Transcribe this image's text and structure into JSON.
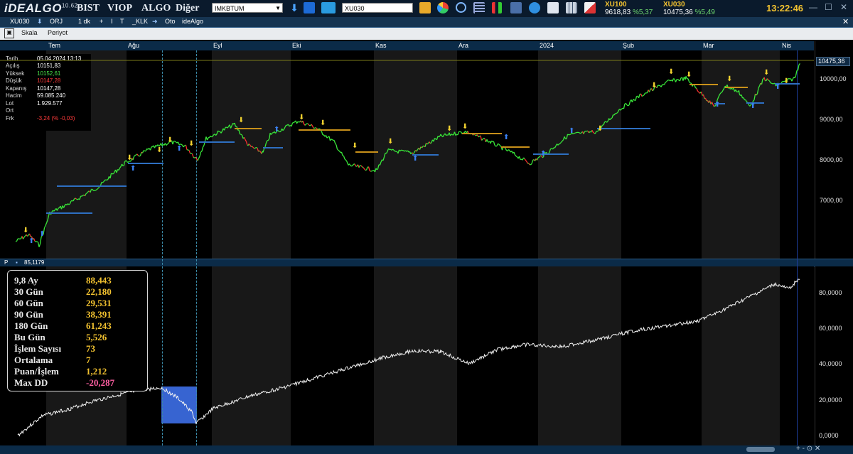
{
  "app": {
    "logo": "iDEALGO",
    "version": "10.62",
    "menu": [
      "BIST",
      "VIOP",
      "ALGO",
      "Diğer"
    ],
    "symbol_select": "IMKBTUM",
    "symbol_input": "XU030",
    "clock": "13:22:46"
  },
  "tickers": [
    {
      "name": "XU100",
      "value": "9618,83",
      "pct": "%5,37"
    },
    {
      "name": "XU030",
      "value": "10475,36",
      "pct": "%5,49"
    }
  ],
  "toolbar_icons": [
    "download-arrow-icon",
    "monitor-icon",
    "folder-icon",
    "pie-chart-icon",
    "magnifier-icon",
    "bars-list-icon",
    "candlestick-icon",
    "camera-icon",
    "globe-icon",
    "cube-icon",
    "grid-icon",
    "brush-icon"
  ],
  "chart_tab": {
    "items": [
      "XU030",
      "ORJ",
      "1 dk",
      "+",
      "I",
      "T",
      "_KLK",
      "Oto",
      "ideAlgo"
    ]
  },
  "toolbar2": {
    "items": [
      "Skala",
      "Periyot"
    ]
  },
  "time_axis": [
    "Tem",
    "Ağu",
    "Eyl",
    "Eki",
    "Kas",
    "Ara",
    "2024",
    "Şub",
    "Mar",
    "Nis"
  ],
  "price_axis": [
    "10000,00",
    "9000,00",
    "8000,00",
    "7000,00"
  ],
  "current_price": "10475,36",
  "info": [
    {
      "label": "Tarih",
      "value": "05.04.2024 13:13",
      "color": "#ffffff"
    },
    {
      "label": "Açılış",
      "value": "10151,83",
      "color": "#ffffff"
    },
    {
      "label": "Yüksek",
      "value": "10152,61",
      "color": "#49e649"
    },
    {
      "label": "Düşük",
      "value": "10147,28",
      "color": "#ff3b3b"
    },
    {
      "label": "Kapanış",
      "value": "10147,28",
      "color": "#ffffff"
    },
    {
      "label": "Hacim",
      "value": "59.085.240",
      "color": "#ffffff"
    },
    {
      "label": "Lot",
      "value": "1.929.577",
      "color": "#ffffff"
    },
    {
      "label": "Ort",
      "value": "",
      "color": "#ffffff"
    },
    {
      "label": "Frk",
      "value": "-3,24 (% -0,03)",
      "color": "#ff3b3b"
    }
  ],
  "equity_pane": {
    "label": "P",
    "value": "85,1179",
    "axis": [
      "80,0000",
      "60,0000",
      "40,0000",
      "20,0000",
      "0,0000"
    ]
  },
  "stats": [
    {
      "label": "9,8 Ay",
      "value": "88,443"
    },
    {
      "label": "30 Gün",
      "value": "22,180"
    },
    {
      "label": "60 Gün",
      "value": "29,531"
    },
    {
      "label": "90 Gün",
      "value": "38,391"
    },
    {
      "label": "180 Gün",
      "value": "61,243"
    },
    {
      "label": "Bu Gün",
      "value": "5,526"
    },
    {
      "label": "İşlem Sayısı",
      "value": "73"
    },
    {
      "label": "Ortalama",
      "value": "7"
    },
    {
      "label": "Puan/İşlem",
      "value": "1,212"
    },
    {
      "label": "Max DD",
      "value": "-20,287"
    }
  ],
  "colors": {
    "up": "#39e639",
    "down": "#ff3030",
    "signal_buy": "#3b82f6",
    "signal_sell": "#f2d230",
    "level_short": "#c8901a",
    "level_long": "#2e6fc2",
    "accent": "#f2c230"
  }
}
